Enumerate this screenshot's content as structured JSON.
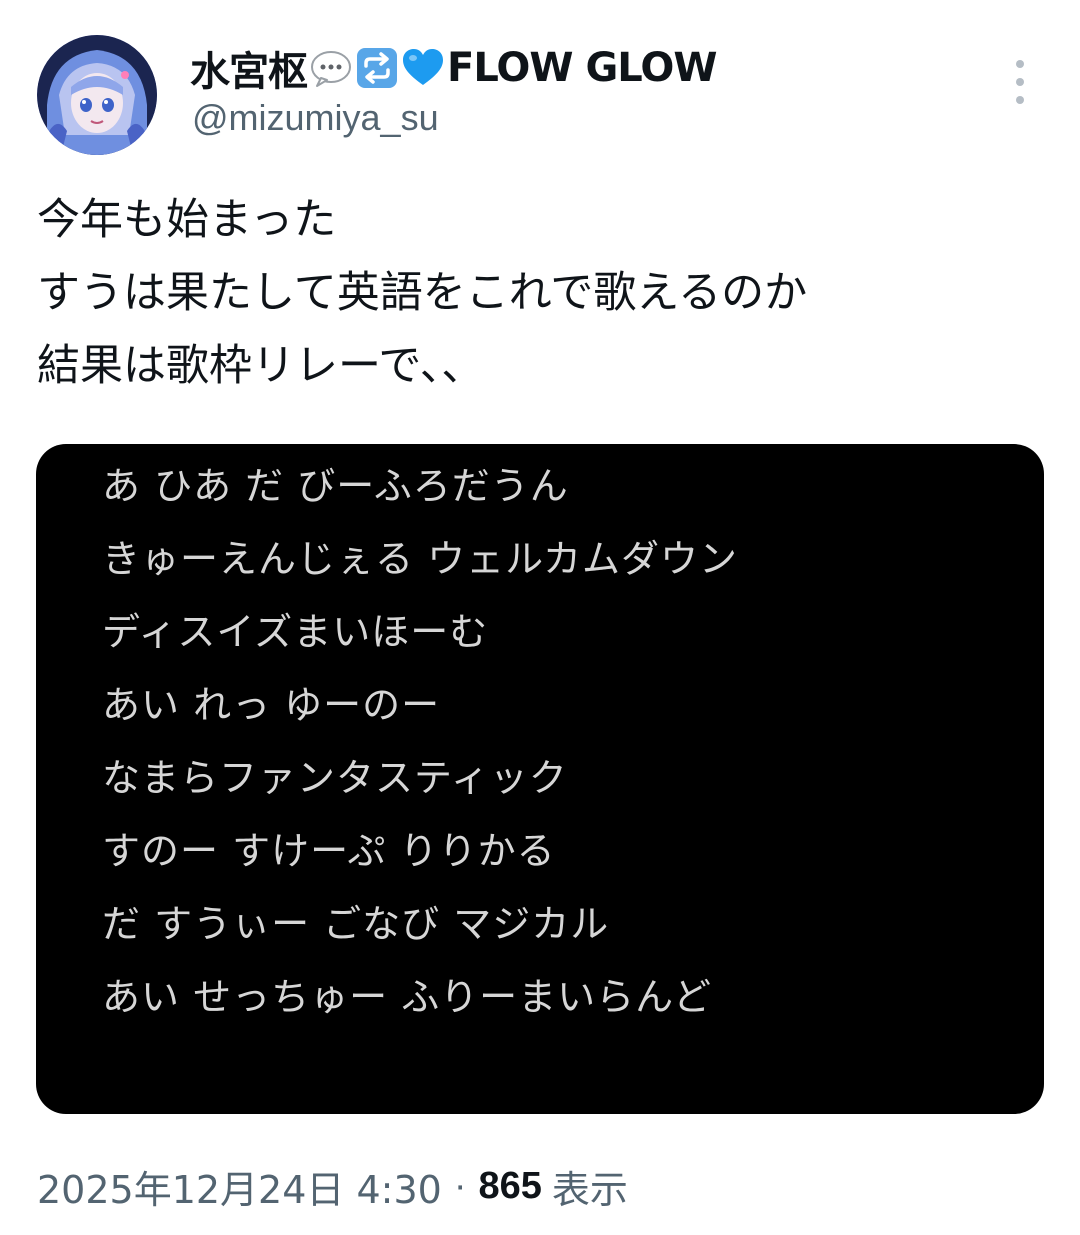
{
  "author": {
    "display_name": "水宮枢",
    "display_name_suffix": "FLOW GLOW",
    "handle": "@mizumiya_su",
    "avatar_icon": "anime-avatar",
    "name_emojis": [
      "speech-bubble-emoji",
      "repeat-arrows-emoji",
      "blue-heart-emoji"
    ]
  },
  "more_icon": "more-vertical-icon",
  "tweet": {
    "lines": [
      "今年も始まった",
      "すうは果たして英語をこれで歌えるのか",
      "結果は歌枠リレーで、、"
    ]
  },
  "media": {
    "lyrics": [
      "あ ひあ だ びーふろだうん",
      "きゅーえんじぇる ウェルカムダウン",
      "ディスイズまいほーむ",
      "あい れっ ゆーのー",
      "なまらファンタスティック",
      "すのー すけーぷ りりかる",
      "だ すうぃー ごなび マジカル",
      "あい せっちゅー ふりーまいらんど"
    ]
  },
  "meta": {
    "date": "2025年12月24日 4:30",
    "separator": "·",
    "views_count": "865",
    "views_label": "表示"
  },
  "colors": {
    "text": "#0f1419",
    "secondary": "#536471",
    "media_bg": "#000000",
    "lyrics_text": "#d6d6d6",
    "heart": "#1d9bf0"
  }
}
